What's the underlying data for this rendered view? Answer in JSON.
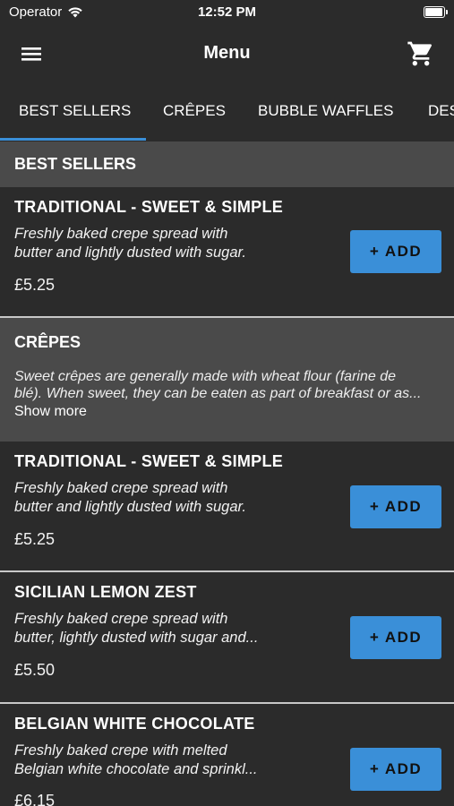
{
  "status_bar": {
    "carrier": "Operator",
    "time": "12:52 PM"
  },
  "nav": {
    "title": "Menu",
    "menu_icon": "hamburger-icon",
    "cart_icon": "cart-icon"
  },
  "tabs": [
    {
      "label": "BEST SELLERS"
    },
    {
      "label": "CRÊPES"
    },
    {
      "label": "BUBBLE WAFFLES"
    },
    {
      "label": "DES"
    }
  ],
  "sections": {
    "best_sellers": {
      "title": "BEST SELLERS",
      "items": [
        {
          "name": "TRADITIONAL - SWEET & SIMPLE",
          "desc_line1": "Freshly baked crepe spread with",
          "desc_line2": "butter and lightly dusted with sugar.",
          "price": "£5.25",
          "add_label": "+ ADD"
        }
      ]
    },
    "crepes": {
      "title": "CRÊPES",
      "desc_line1": "Sweet crêpes are generally made with wheat flour (farine de",
      "desc_line2": "blé). When sweet, they can be eaten as part of breakfast or as...",
      "show_more": "Show more",
      "items": [
        {
          "name": "TRADITIONAL - SWEET & SIMPLE",
          "desc_line1": "Freshly baked crepe spread with",
          "desc_line2": "butter and lightly dusted with sugar.",
          "price": "£5.25",
          "add_label": "+ ADD"
        },
        {
          "name": "SICILIAN LEMON ZEST",
          "desc_line1": "Freshly baked crepe spread with",
          "desc_line2": "butter, lightly dusted with sugar and...",
          "price": "£5.50",
          "add_label": "+ ADD"
        },
        {
          "name": "BELGIAN WHITE CHOCOLATE",
          "desc_line1": "Freshly baked crepe with melted",
          "desc_line2": "Belgian white chocolate and sprinkl...",
          "price": "£6.15",
          "add_label": "+ ADD"
        }
      ]
    }
  },
  "colors": {
    "accent": "#3a8fd8",
    "background": "#2b2b2b",
    "section_header": "#4a4a4a"
  }
}
